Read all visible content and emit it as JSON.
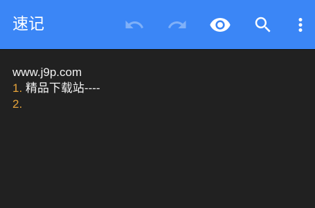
{
  "app": {
    "title": "速记"
  },
  "toolbar": {
    "icons": {
      "undo": "undo-icon",
      "redo": "redo-icon",
      "preview": "eye-icon",
      "search": "search-icon",
      "more": "more-vert-icon"
    }
  },
  "editor": {
    "lines": [
      {
        "marker": "",
        "text": "www.j9p.com"
      },
      {
        "marker": "1.",
        "text": " 精品下载站----"
      },
      {
        "marker": "2.",
        "text": ""
      }
    ]
  },
  "colors": {
    "appbar": "#3b86f6",
    "background": "#212121",
    "text": "#f2f2f2",
    "list_number": "#e6a33a",
    "disabled_icon": "#7fb0f8"
  }
}
